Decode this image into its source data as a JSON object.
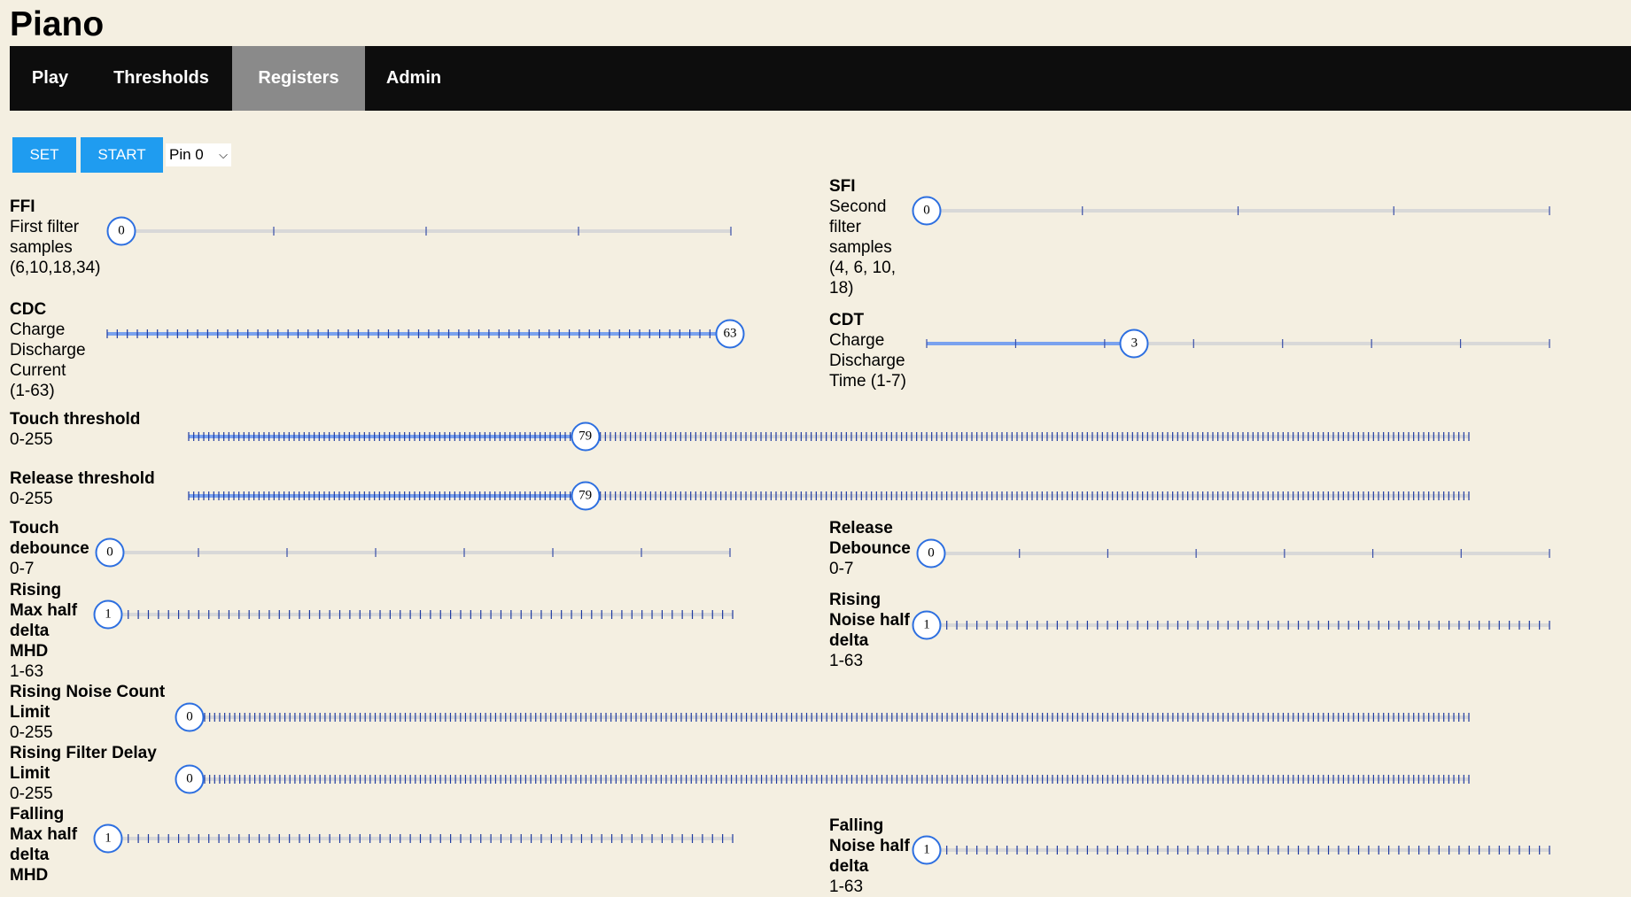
{
  "page": {
    "title": "Piano"
  },
  "nav": {
    "tabs": [
      {
        "label": "Play"
      },
      {
        "label": "Thresholds"
      },
      {
        "label": "Registers",
        "active": true
      },
      {
        "label": "Admin"
      }
    ]
  },
  "toolbar": {
    "set_label": "SET",
    "start_label": "START",
    "pin_selected": "Pin 0"
  },
  "colors": {
    "accent": "#2d6fe0",
    "tick": "#1e3aa0",
    "button": "#1f9cf0",
    "nav_bg": "#0d0d0d",
    "nav_active": "#8a8a8a",
    "page_bg": "#f4efe1"
  },
  "registers": [
    {
      "id": "ffi",
      "name": "FFI",
      "desc": [
        "First filter",
        "samples",
        "(6,10,18,34)"
      ],
      "min": 0,
      "max": 3,
      "value": 0
    },
    {
      "id": "sfi",
      "name": "SFI",
      "desc": [
        "Second",
        "filter",
        "samples",
        "(4, 6, 10,",
        "18)"
      ],
      "min": 0,
      "max": 3,
      "value": 0
    },
    {
      "id": "cdc",
      "name": "CDC",
      "desc": [
        "Charge",
        "Discharge",
        "Current",
        "(1-63)"
      ],
      "min": 1,
      "max": 63,
      "value": 63
    },
    {
      "id": "cdt",
      "name": "CDT",
      "desc": [
        "Charge",
        "Discharge",
        "Time (1-7)"
      ],
      "min": 1,
      "max": 7,
      "value": 3
    },
    {
      "id": "touch-threshold",
      "name": "Touch threshold",
      "desc": [
        "0-255"
      ],
      "min": 0,
      "max": 255,
      "value": 79
    },
    {
      "id": "release-threshold",
      "name": "Release threshold",
      "desc": [
        "0-255"
      ],
      "min": 0,
      "max": 255,
      "value": 79
    },
    {
      "id": "touch-debounce",
      "name": "Touch debounce",
      "desc": [
        "0-7"
      ],
      "min": 0,
      "max": 7,
      "value": 0
    },
    {
      "id": "release-debounce",
      "name": "Release Debounce",
      "desc": [
        "0-7"
      ],
      "min": 0,
      "max": 7,
      "value": 0
    },
    {
      "id": "rising-mhd",
      "name": "Rising Max half delta MHD",
      "desc": [
        "1-63"
      ],
      "min": 1,
      "max": 63,
      "value": 1
    },
    {
      "id": "rising-nhd",
      "name": "Rising Noise half delta",
      "desc": [
        "1-63"
      ],
      "min": 1,
      "max": 63,
      "value": 1
    },
    {
      "id": "rising-ncl",
      "name": "Rising Noise Count Limit",
      "desc": [
        "0-255"
      ],
      "min": 0,
      "max": 255,
      "value": 0
    },
    {
      "id": "rising-fdl",
      "name": "Rising Filter Delay Limit",
      "desc": [
        "0-255"
      ],
      "min": 0,
      "max": 255,
      "value": 0
    },
    {
      "id": "falling-mhd",
      "name": "Falling Max half delta MHD",
      "desc": [],
      "min": 1,
      "max": 63,
      "value": 1
    },
    {
      "id": "falling-nhd",
      "name": "Falling Noise half delta",
      "desc": [
        "1-63"
      ],
      "min": 1,
      "max": 63,
      "value": 1
    }
  ]
}
